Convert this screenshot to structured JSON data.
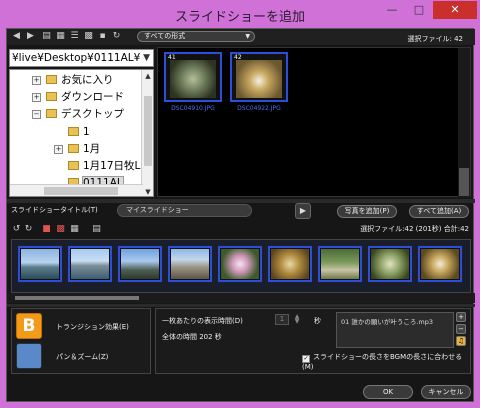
{
  "window": {
    "title": "スライドショーを追加",
    "minimize_glyph": "—",
    "maximize_glyph": "□",
    "close_glyph": "✕"
  },
  "toolbar": {
    "filter_value": "すべての形式",
    "selected_files": "選択ファイル: 42"
  },
  "path": {
    "value": "¥live¥Desktop¥0111AL¥"
  },
  "tree": {
    "items": [
      {
        "label": "お気に入り",
        "expander": "+"
      },
      {
        "label": "ダウンロード",
        "expander": "+"
      },
      {
        "label": "デスクトップ",
        "expander": "−"
      },
      {
        "label": "1",
        "expander": ""
      },
      {
        "label": "1月",
        "expander": "+"
      },
      {
        "label": "1月17日牧L",
        "expander": ""
      },
      {
        "label": "0111AL",
        "expander": ""
      }
    ]
  },
  "browser": {
    "thumbs": [
      {
        "index": "41",
        "name": "DSC04910.JPG"
      },
      {
        "index": "42",
        "name": "DSC04922.JPG"
      }
    ]
  },
  "slideshow": {
    "title_label": "スライドショータイトル(T)",
    "title_value": "マイスライドショー",
    "add_photo_button": "写真を追加(P)",
    "add_all_button": "すべて追加(A)",
    "info": "選択ファイル:42 (201秒) 合計:42"
  },
  "effects": {
    "transition_label": "トランジション効果(E)",
    "pan_zoom_label": "パン＆ズーム(Z)"
  },
  "settings": {
    "duration_label": "一枚あたりの表示時間(D)",
    "duration_value": "1",
    "seconds_unit": "秒",
    "total_time": "全体の時間 202 秒",
    "bgm_item": "01 誰かの願いが叶うころ.mp3",
    "fit_bgm_label": "スライドショーの長さをBGMの長さに合わせる(M)",
    "fit_bgm_checked": "✓"
  },
  "dialog": {
    "ok": "OK",
    "cancel": "キャンセル"
  }
}
